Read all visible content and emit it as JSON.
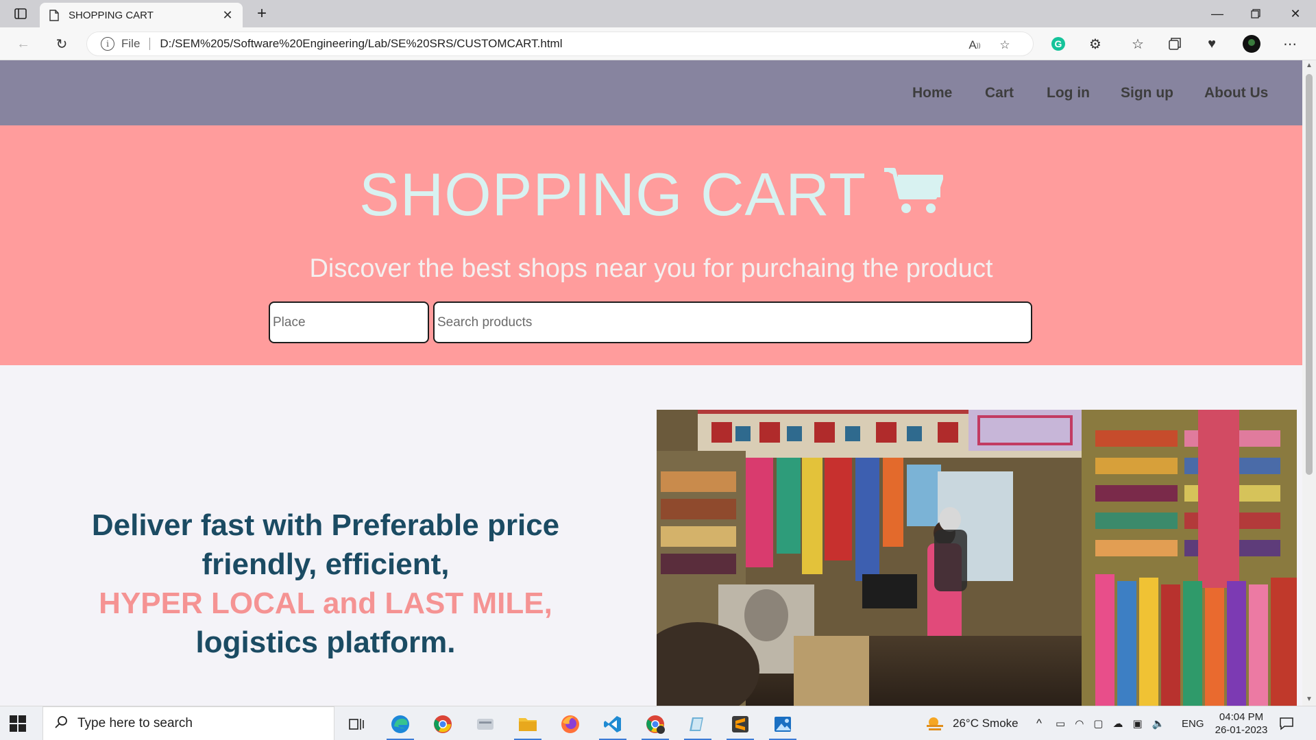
{
  "browser": {
    "tab_title": "SHOPPING CART",
    "address_prefix": "File",
    "url": "D:/SEM%205/Software%20Engineering/Lab/SE%20SRS/CUSTOMCART.html"
  },
  "site": {
    "nav": {
      "home": "Home",
      "cart": "Cart",
      "login": "Log in",
      "signup": "Sign up",
      "about": "About Us"
    },
    "hero": {
      "title": "SHOPPING CART",
      "subtitle": "Discover the best shops near you for purchaing the product",
      "place_placeholder": "Place",
      "search_placeholder": "Search products"
    },
    "feature": {
      "line1": "Deliver fast with Preferable price",
      "line2": "friendly, efficient,",
      "line3_accent": "HYPER LOCAL and LAST MILE,",
      "line4": "logistics platform."
    }
  },
  "taskbar": {
    "search_placeholder": "Type here to search",
    "weather": "26°C  Smoke",
    "language": "ENG",
    "time": "04:04 PM",
    "date": "26-01-2023"
  },
  "colors": {
    "nav_bg": "#87849f",
    "hero_bg": "#ff9c9c",
    "hero_title": "#d8f2f1",
    "feature_text": "#1b4b63",
    "feature_accent": "#f59393"
  }
}
